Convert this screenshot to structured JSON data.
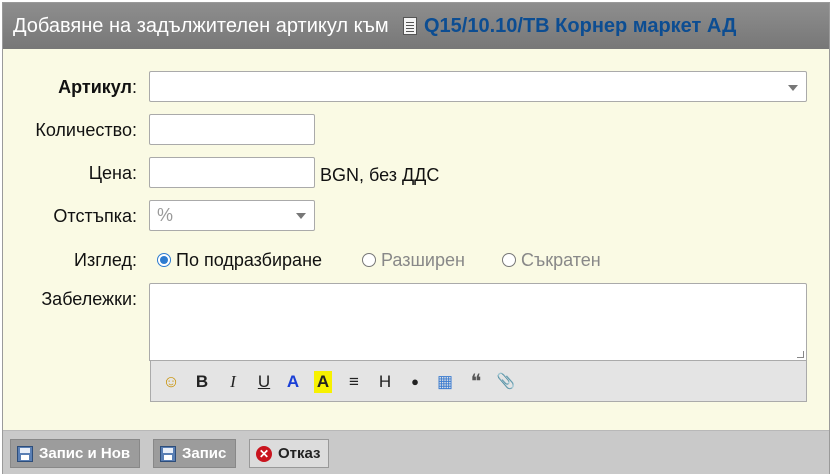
{
  "titlebar": {
    "title": "Добавяне на задължителен артикул към",
    "doc_icon": "document-icon",
    "link": "Q15/10.10/TB Корнер маркет АД"
  },
  "form": {
    "article_label": "Артикул",
    "article_colon": ":",
    "quantity_label": "Количество:",
    "price_label": "Цена:",
    "price_suffix": "BGN, без ДДС",
    "discount_label": "Отстъпка:",
    "discount_placeholder": "%",
    "view_label": "Изглед:",
    "view_options": [
      "По подразбиране",
      "Разширен",
      "Съкратен"
    ],
    "view_selected": "По подразбиране",
    "notes_label": "Забележки:"
  },
  "editor_toolbar": [
    {
      "name": "smiley-icon",
      "glyph": "☺"
    },
    {
      "name": "bold-button",
      "glyph": "B"
    },
    {
      "name": "italic-button",
      "glyph": "I"
    },
    {
      "name": "underline-button",
      "glyph": "U"
    },
    {
      "name": "font-color-button",
      "glyph": "A"
    },
    {
      "name": "highlight-button",
      "glyph": "A"
    },
    {
      "name": "align-icon",
      "glyph": "≡"
    },
    {
      "name": "heading-button",
      "glyph": "H"
    },
    {
      "name": "bullet-button",
      "glyph": "●"
    },
    {
      "name": "table-icon",
      "glyph": "▦"
    },
    {
      "name": "quote-icon",
      "glyph": "❝"
    },
    {
      "name": "attach-icon",
      "glyph": "📎"
    }
  ],
  "footer": {
    "save_new": "Запис и Нов",
    "save": "Запис",
    "cancel": "Отказ"
  },
  "colors": {
    "title_link": "#0c4d92",
    "radio_selected": "#2d7bd0",
    "cancel_icon": "#c9141e"
  }
}
